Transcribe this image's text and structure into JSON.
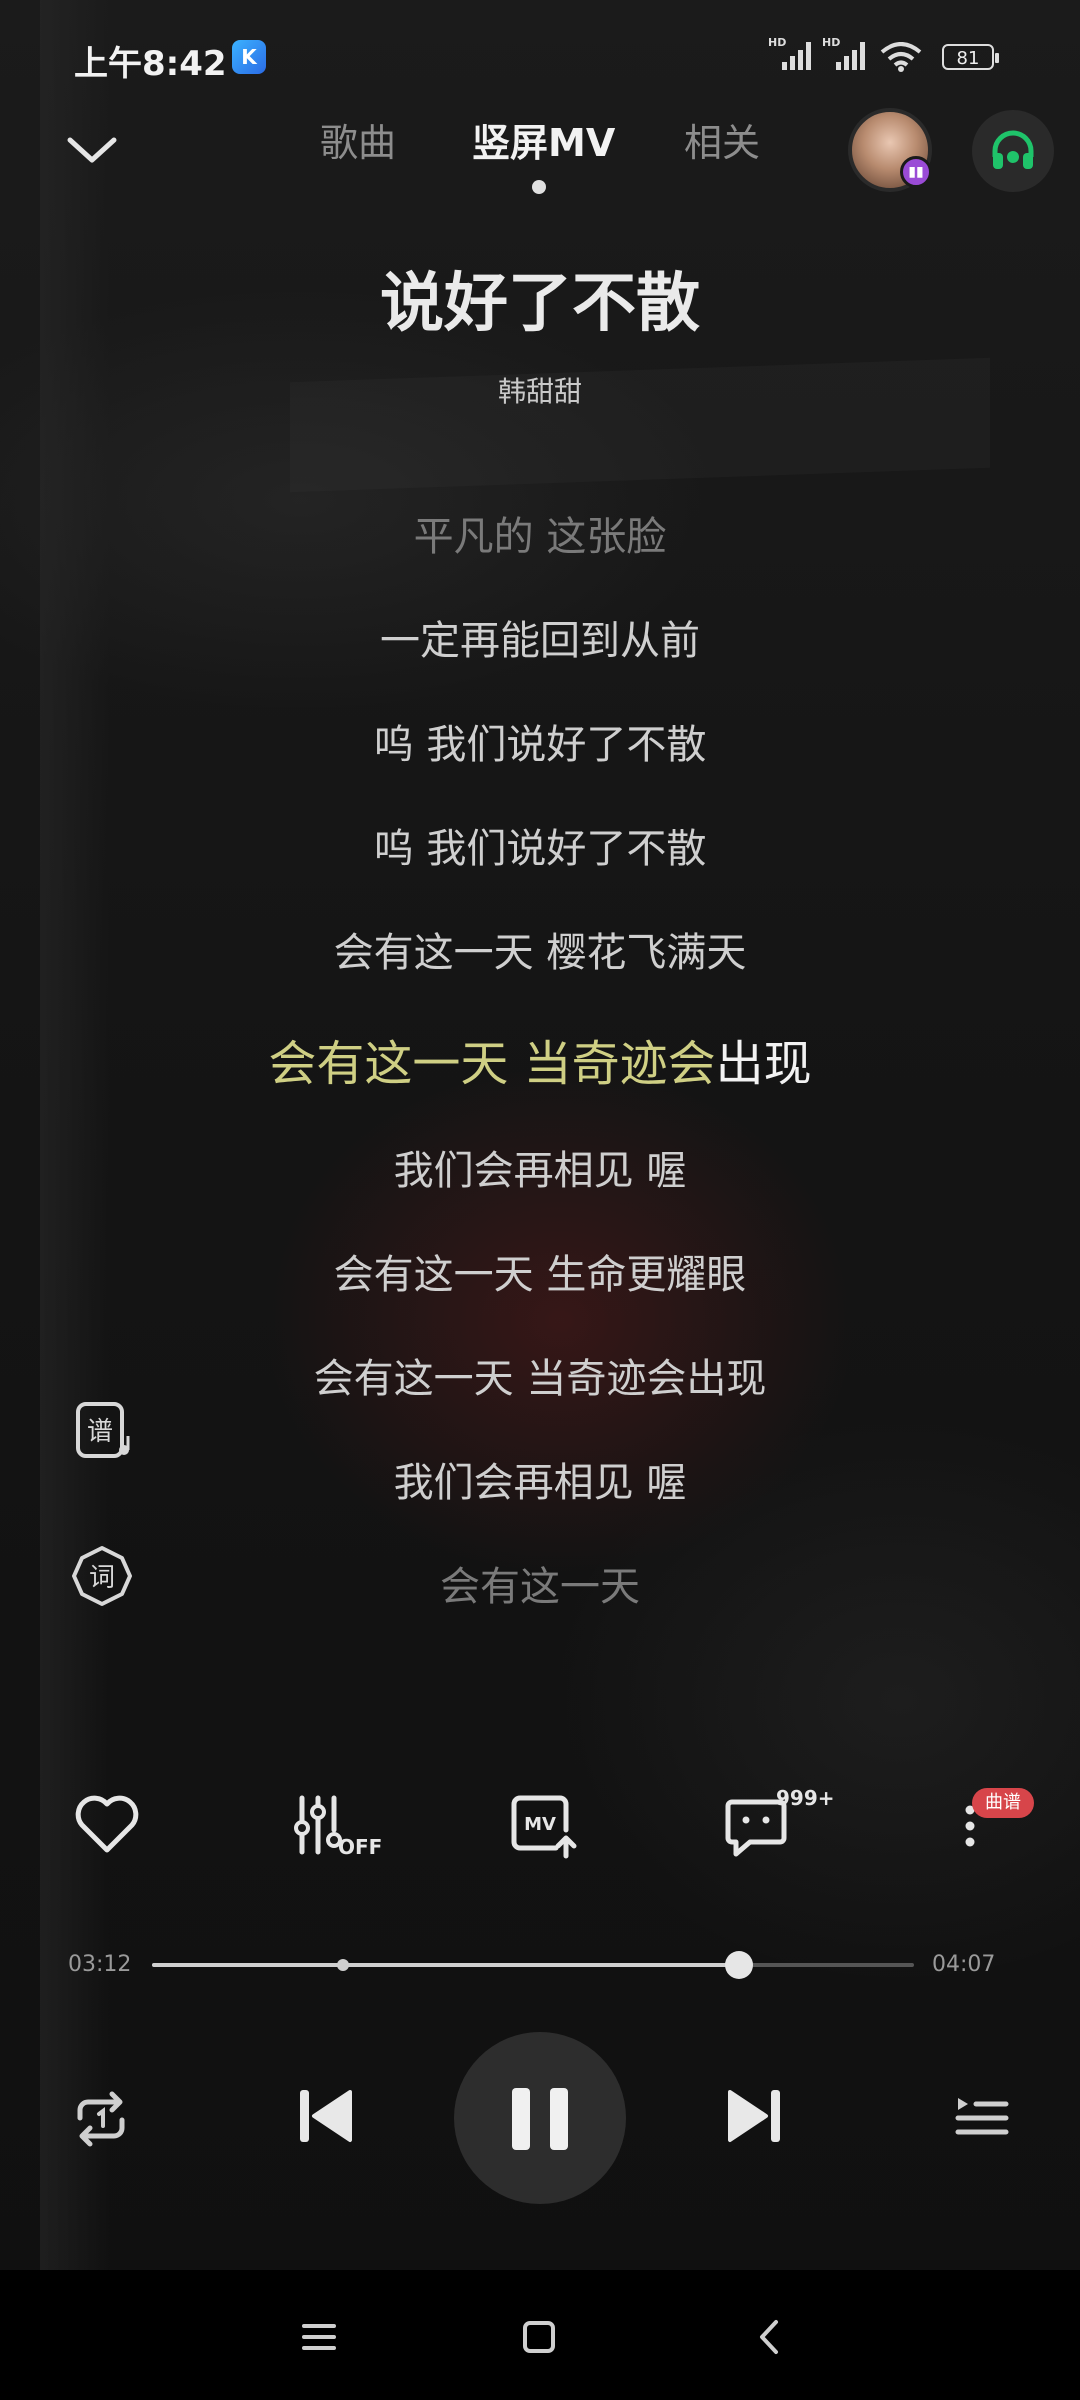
{
  "status_bar": {
    "time": "上午8:42",
    "signal_labels": [
      "HD",
      "HD"
    ],
    "battery": "81"
  },
  "header": {
    "tabs": [
      {
        "label": "歌曲",
        "active": false
      },
      {
        "label": "竖屏MV",
        "active": true
      },
      {
        "label": "相关",
        "active": false
      }
    ]
  },
  "song": {
    "title": "说好了不散",
    "artist": "韩甜甜"
  },
  "lyrics": {
    "lines": [
      {
        "text": "平凡的 这张脸",
        "style": "dim"
      },
      {
        "text": "一定再能回到从前",
        "style": "normal"
      },
      {
        "text": "呜 我们说好了不散",
        "style": "normal"
      },
      {
        "text": "呜 我们说好了不散",
        "style": "normal"
      },
      {
        "text": "会有这一天 樱花飞满天",
        "style": "normal"
      },
      {
        "sung": "会有这一天 当奇迹会",
        "unsung": "出现",
        "style": "active"
      },
      {
        "text": "我们会再相见 喔",
        "style": "normal"
      },
      {
        "text": "会有这一天 生命更耀眼",
        "style": "normal"
      },
      {
        "text": "会有这一天 当奇迹会出现",
        "style": "normal"
      },
      {
        "text": "我们会再相见 喔",
        "style": "normal"
      },
      {
        "text": "会有这一天",
        "style": "dim"
      }
    ],
    "highlight_color": "#cfcf84"
  },
  "side_tools": {
    "sheet_icon_label": "谱",
    "lyric_icon_label": "词"
  },
  "actions": {
    "eq_off_label": "OFF",
    "mv_label": "MV",
    "comment_count": "999+",
    "more_badge": "曲谱"
  },
  "progress": {
    "current": "03:12",
    "total": "04:07",
    "played_fraction": 0.77,
    "marker_fraction": 0.25
  },
  "colors": {
    "accent_green": "#1fc36a",
    "badge_red": "#d7454a",
    "avatar_badge": "#9a4bd6"
  }
}
